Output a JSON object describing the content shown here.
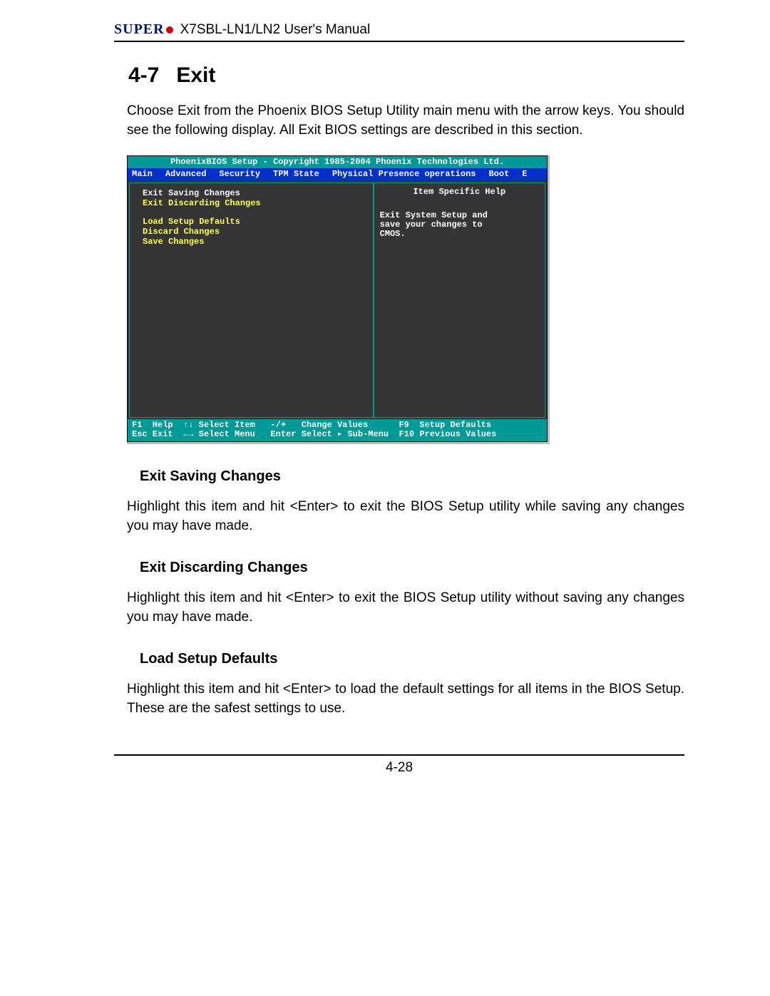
{
  "header": {
    "brand": "SUPER",
    "manual_title": "X7SBL-LN1/LN2 User's Manual"
  },
  "section": {
    "number": "4-7",
    "title": "Exit"
  },
  "intro": "Choose Exit from the Phoenix BIOS Setup Utility main menu with the arrow keys. You should see the following display. All Exit BIOS settings are described in this section.",
  "bios": {
    "titlebar": "PhoenixBIOS Setup - Copyright 1985-2004 Phoenix Technologies Ltd.",
    "menus": [
      "Main",
      "Advanced",
      "Security",
      "TPM State",
      "Physical Presence operations",
      "Boot",
      "E"
    ],
    "items": [
      "Exit Saving Changes",
      "Exit Discarding Changes",
      "",
      "Load Setup Defaults",
      "Discard Changes",
      "Save Changes"
    ],
    "help_title": "Item Specific Help",
    "help_body": "Exit System Setup and\nsave your changes to\nCMOS.",
    "footer": {
      "row1": "F1  Help  ↑↓ Select Item   -/+   Change Values      F9  Setup Defaults",
      "row2": "Esc Exit  ←→ Select Menu   Enter Select ▸ Sub-Menu  F10 Previous Values"
    }
  },
  "subsections": [
    {
      "heading": "Exit Saving Changes",
      "body": "Highlight this item and hit <Enter> to exit the BIOS Setup utility while saving any changes you may have made."
    },
    {
      "heading": "Exit Discarding Changes",
      "body": "Highlight this item and hit <Enter> to exit the BIOS Setup utility without saving any changes you may have made."
    },
    {
      "heading": "Load Setup Defaults",
      "body": "Highlight this item and hit <Enter> to load the default settings for all items in the BIOS Setup.  These are the safest settings to use."
    }
  ],
  "page_number": "4-28"
}
